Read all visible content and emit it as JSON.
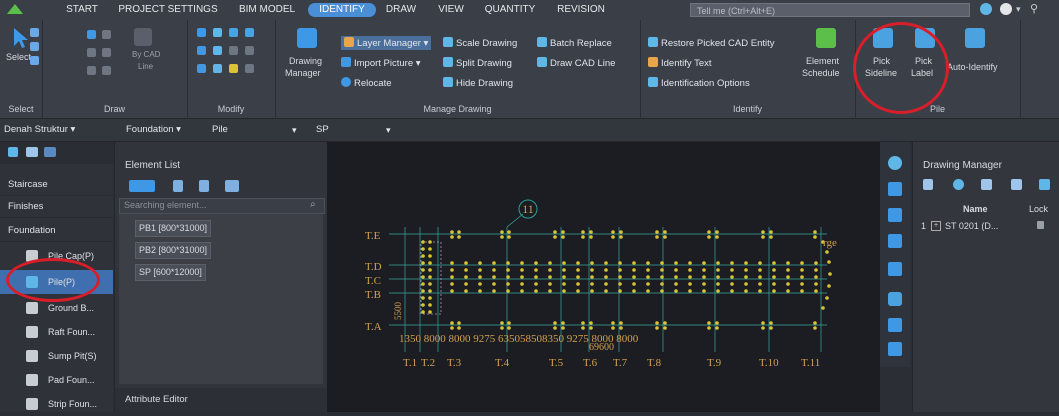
{
  "menu": {
    "tabs": [
      "START",
      "PROJECT SETTINGS",
      "BIM MODEL",
      "IDENTIFY",
      "DRAW",
      "VIEW",
      "QUANTITY",
      "REVISION"
    ],
    "active": "IDENTIFY",
    "tell_me": "Tell me (Ctrl+Alt+E)"
  },
  "ribbon": {
    "select": {
      "label": "Select",
      "group": "Select"
    },
    "draw": {
      "by_cad": "By CAD",
      "line": "Line",
      "group": "Draw"
    },
    "modify": {
      "group": "Modify"
    },
    "drawing_manager": {
      "label1": "Drawing",
      "label2": "Manager"
    },
    "manage": {
      "layer_manager": "Layer Manager",
      "scale_drawing": "Scale Drawing",
      "batch_replace": "Batch Replace",
      "import_picture": "Import Picture",
      "split_drawing": "Split Drawing",
      "draw_cad_line": "Draw CAD Line",
      "relocate": "Relocate",
      "hide_drawing": "Hide Drawing",
      "group": "Manage Drawing"
    },
    "identify": {
      "restore": "Restore Picked CAD Entity",
      "identify_text": "Identify Text",
      "identification_options": "Identification Options",
      "element_schedule1": "Element",
      "element_schedule2": "Schedule",
      "group": "Identify"
    },
    "pile": {
      "pick_sideline1": "Pick",
      "pick_sideline2": "Sideline",
      "pick_label1": "Pick",
      "pick_label2": "Label",
      "auto_identify": "Auto-Identify",
      "group": "Pile"
    }
  },
  "floorbar": {
    "floor": "Denah Struktur",
    "category": "Foundation",
    "element": "Pile",
    "subtype": "SP"
  },
  "leftpanel": {
    "categories": [
      "Staircase",
      "Finishes",
      "Foundation"
    ],
    "items": [
      "Pile Cap(P)",
      "Pile(P)",
      "Ground B...",
      "Raft Foun...",
      "Sump Pit(S)",
      "Pad Foun...",
      "Strip Foun..."
    ]
  },
  "elementlist": {
    "title": "Element List",
    "search_placeholder": "Searching element...",
    "items": [
      "PB1 [800*31000]",
      "PB2 [800*31000]",
      "SP [600*12000]"
    ],
    "attribute_editor": "Attribute Editor"
  },
  "canvas": {
    "grid_top": "11",
    "rows": [
      "T.E",
      "T.D",
      "T.C",
      "T.B",
      "T.A"
    ],
    "left_dim": "5500",
    "dims": "1350 8000 8000 9275 635058508350 9275 8000 8000",
    "dim_sub": "69600",
    "cols": [
      "T.1",
      "T.2",
      "T.3",
      "T.4",
      "T.5",
      "T.6",
      "T.7",
      "T.8",
      "T.9",
      "T.10",
      "T.11"
    ],
    "edge_text": "rge"
  },
  "drawing_manager": {
    "title": "Drawing Manager",
    "col_name": "Name",
    "col_lock": "Lock",
    "row_index": "1",
    "row_name": "ST 0201 (D..."
  },
  "colors": {
    "accent": "#4a8ed8",
    "highlight": "#d81e2a",
    "pile_dot": "#d9c437",
    "grid": "#3aa8a0",
    "gridline": "#7a7a60"
  }
}
